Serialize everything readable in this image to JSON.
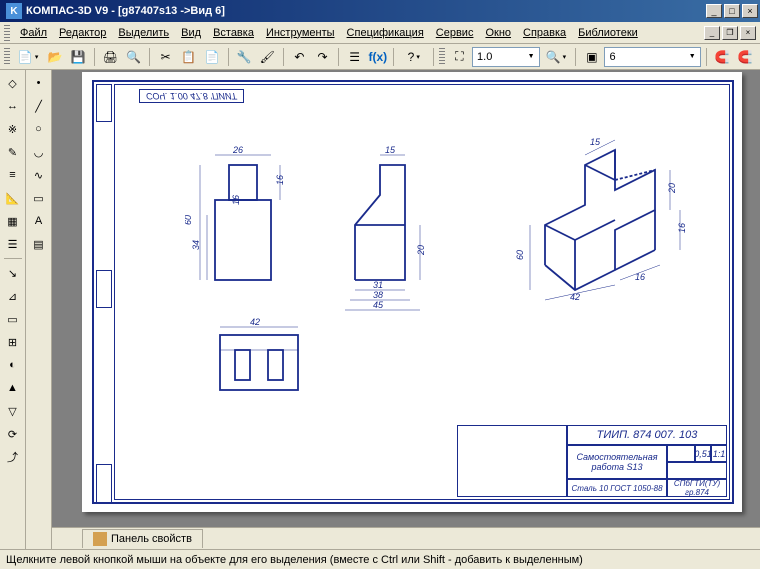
{
  "title": "КОМПАС-3D V9 - [g87407s13 ->Вид 6]",
  "menu": [
    "Файл",
    "Редактор",
    "Выделить",
    "Вид",
    "Вставка",
    "Инструменты",
    "Спецификация",
    "Сервис",
    "Окно",
    "Справка",
    "Библиотеки"
  ],
  "toolbar": {
    "scale_combo": "1.0",
    "page_combo": "6"
  },
  "drawing": {
    "stamp_top": "СОЧ. 1.00 47.8 'ПИИТ",
    "title_block": {
      "code": "ТИИП. 874 007. 103",
      "name": "Самостоятельная работа S13",
      "material": "Сталь 10 ГОСТ 1050-88",
      "mass": "0,51",
      "scale": "1:1",
      "org": "СПбГТИ(ТУ) гр.874"
    },
    "dims": {
      "front_w": "26",
      "front_h": "60",
      "front_h2": "34",
      "front_slot": "16",
      "front_slot2": "16",
      "side_top": "15",
      "side_h": "20",
      "side_w1": "31",
      "side_w2": "38",
      "side_w3": "45",
      "top_w": "42",
      "iso_a": "15",
      "iso_b": "20",
      "iso_c": "16",
      "iso_d": "60",
      "iso_e": "42",
      "iso_f": "16"
    }
  },
  "panel": {
    "properties_tab": "Панель свойств"
  },
  "status": "Щелкните левой кнопкой мыши на объекте для его выделения (вместе с Ctrl или Shift - добавить к выделенным)"
}
